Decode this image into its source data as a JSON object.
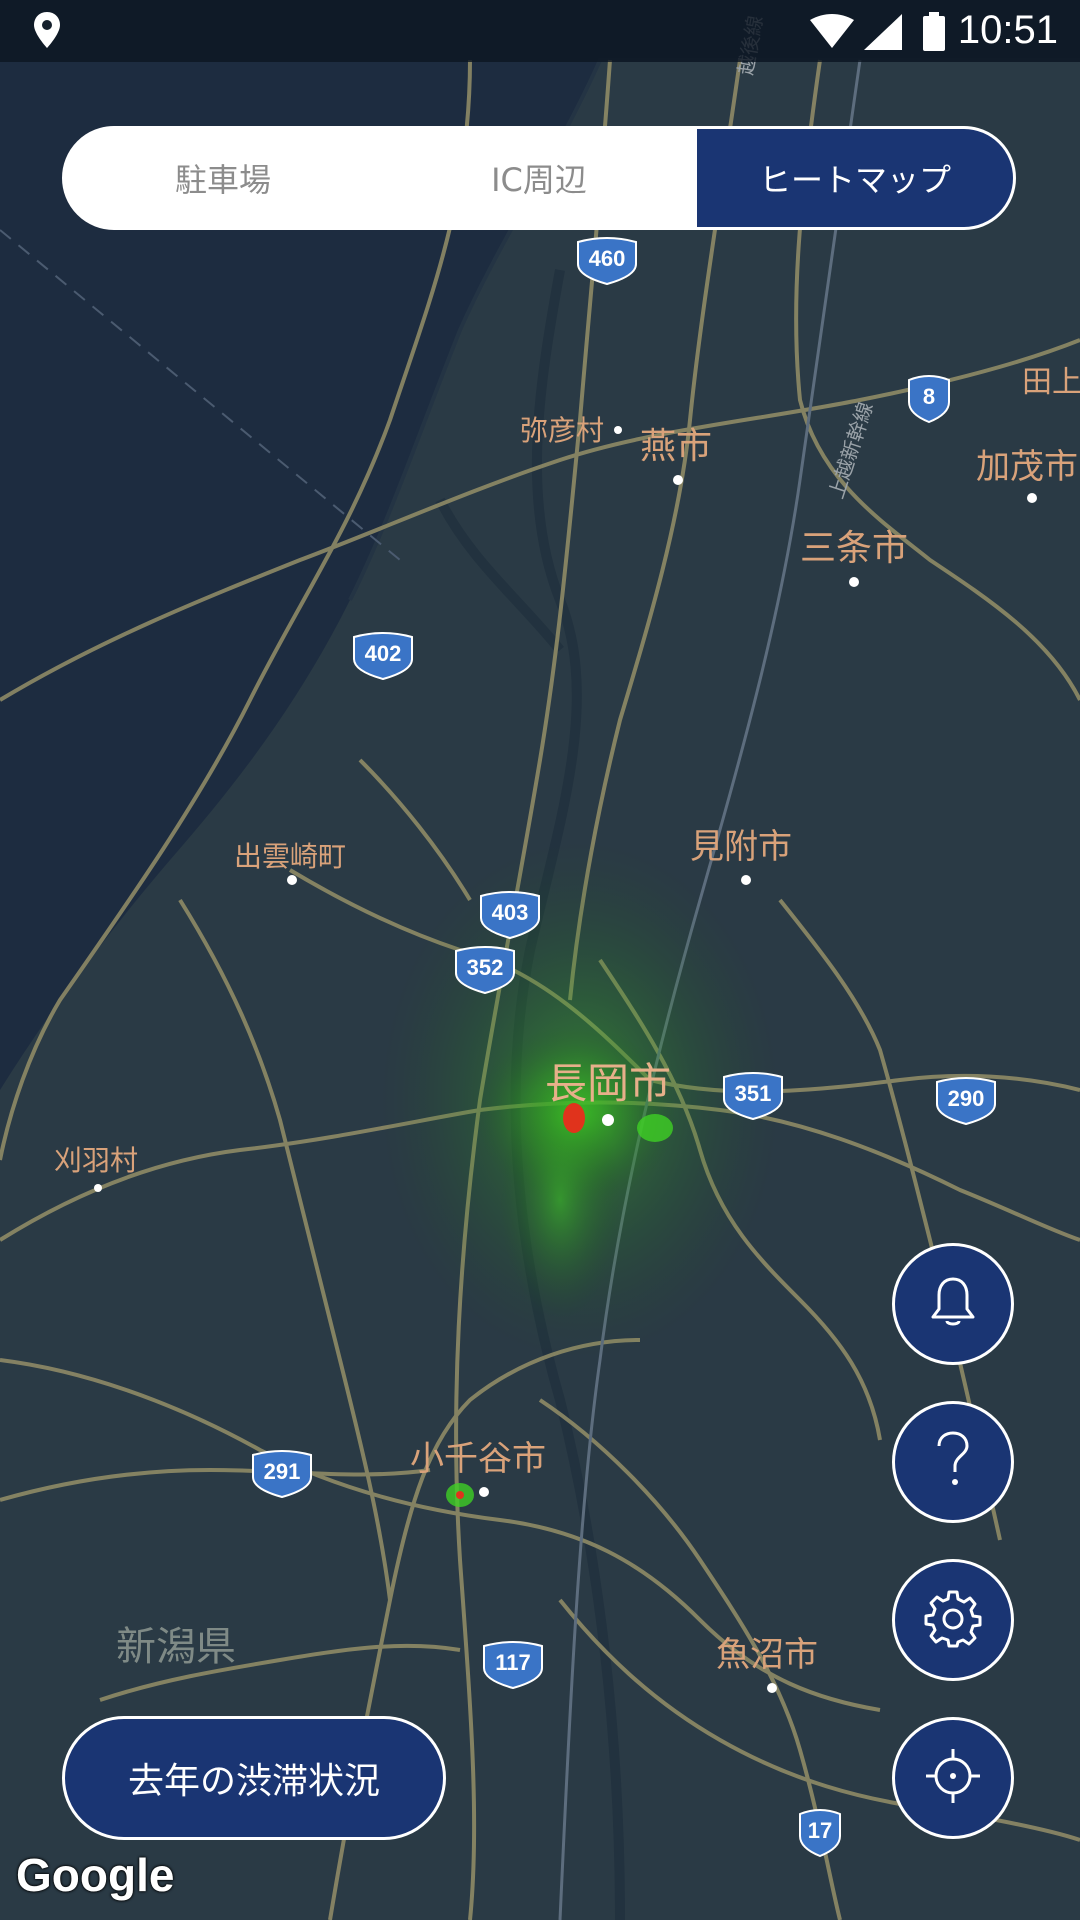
{
  "status_bar": {
    "time": "10:51"
  },
  "tabs": [
    {
      "label": "駐車場",
      "active": false
    },
    {
      "label": "IC周辺",
      "active": false
    },
    {
      "label": "ヒートマップ",
      "active": true
    }
  ],
  "map": {
    "cities": {
      "nagaoka": "長岡市",
      "sanjo": "三条市",
      "tsubame": "燕市",
      "yahiko": "弥彦村",
      "mitsuke": "見附市",
      "izumozaki": "出雲崎町",
      "kariwa": "刈羽村",
      "ojiya": "小千谷市",
      "uonuma": "魚沼市",
      "kamo": "加茂市",
      "tagami": "田上",
      "prefecture": "新潟県"
    },
    "rail_labels": {
      "joetsu_shinkansen": "上越新幹線",
      "echigo": "越後線"
    },
    "routes": {
      "r460": "460",
      "r8": "8",
      "r402": "402",
      "r403": "403",
      "r352": "352",
      "r351": "351",
      "r290": "290",
      "r291": "291",
      "r117": "117",
      "r17": "17"
    },
    "colors": {
      "land": "#2a3a45",
      "sea": "#1d2c40",
      "road": "#8e8a66",
      "heat": "#39c21f",
      "heat_hot": "#e0331c"
    }
  },
  "buttons": {
    "traffic_history": "去年の渋滞状況",
    "notification_icon": "bell-icon",
    "help_icon": "question-icon",
    "settings_icon": "gear-icon",
    "location_icon": "crosshair-icon"
  },
  "attribution": "Google"
}
